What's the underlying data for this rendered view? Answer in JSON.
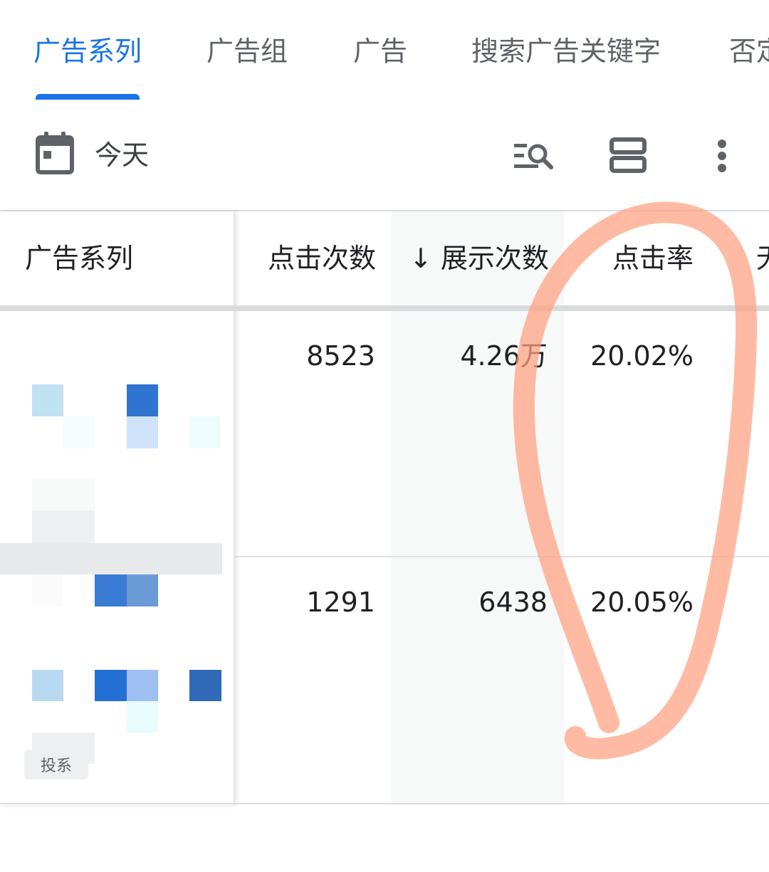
{
  "tabs": [
    {
      "label": "广告系列",
      "active": true
    },
    {
      "label": "广告组",
      "active": false
    },
    {
      "label": "广告",
      "active": false
    },
    {
      "label": "搜索广告关键字",
      "active": false
    },
    {
      "label": "否定",
      "active": false
    }
  ],
  "toolbar": {
    "date_range": "今天",
    "icons": [
      "calendar-icon",
      "filter-search-icon",
      "density-icon",
      "more-vert-icon"
    ]
  },
  "table": {
    "columns": [
      {
        "label": "广告系列"
      },
      {
        "label": "点击次数"
      },
      {
        "label": "↓ 展示次数",
        "sorted": "desc"
      },
      {
        "label": "点击率"
      },
      {
        "label": "无"
      }
    ],
    "rows": [
      {
        "clicks": "8523",
        "impressions": "4.26万",
        "ctr": "20.02%"
      },
      {
        "clicks": "1291",
        "impressions": "6438",
        "ctr": "20.05%"
      }
    ],
    "row2_badge": "投系"
  },
  "colors": {
    "accent": "#1a73e8",
    "annotation": "#ff9f80",
    "text": "#202124",
    "muted": "#5f6368"
  }
}
